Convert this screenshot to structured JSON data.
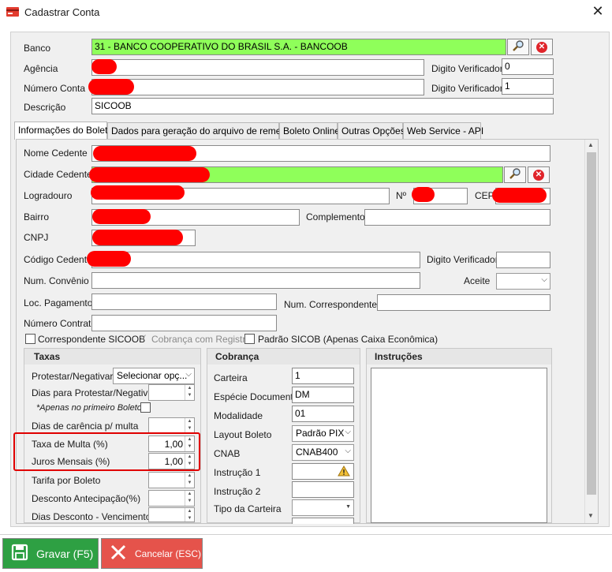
{
  "window": {
    "title": "Cadastrar Conta"
  },
  "form": {
    "banco_label": "Banco",
    "banco_value": "31 - BANCO COOPERATIVO DO BRASIL S.A. - BANCOOB",
    "agencia_label": "Agência",
    "digito_label": "Digito Verificador",
    "digito_agencia": "0",
    "numero_conta_label": "Número Conta",
    "digito_conta": "1",
    "descricao_label": "Descrição",
    "descricao_value": "SICOOB"
  },
  "tabs": [
    {
      "label": "Informações do Boleto"
    },
    {
      "label": "Dados para geração do arquivo de remessa"
    },
    {
      "label": "Boleto Online"
    },
    {
      "label": "Outras Opções"
    },
    {
      "label": "Web Service - API"
    }
  ],
  "boleto": {
    "nome_cedente": "Nome Cedente",
    "cidade_cedente": "Cidade Cedente",
    "logradouro": "Logradouro",
    "numero": "Nº",
    "cep": "CEP",
    "bairro": "Bairro",
    "complemento": "Complemento",
    "cnpj": "CNPJ",
    "codigo_cedente": "Código Cedente",
    "digito_verificador": "Digito Verificador",
    "num_convenio": "Num. Convênio",
    "aceite": "Aceite",
    "loc_pagamento": "Loc. Pagamento",
    "num_correspondente": "Num. Correspondente",
    "numero_contrato": "Número Contrato",
    "chk_correspondente": "Correspondente SICOOB",
    "chk_cobranca_registro": "Cobrança com Registro",
    "chk_padrao_sicob": "Padrão SICOB (Apenas Caixa Econômica)"
  },
  "taxas": {
    "title": "Taxas",
    "protestar_label": "Protestar/Negativar?",
    "protestar_value": "Selecionar opç...",
    "dias_protestar_label": "Dias para Protestar/Negativar",
    "apenas_primeiro": "*Apenas no primeiro Boleto",
    "dias_carencia_label": "Dias de carência p/ multa",
    "taxa_multa_label": "Taxa de Multa (%)",
    "taxa_multa_value": "1,00",
    "juros_label": "Juros Mensais (%)",
    "juros_value": "1,00",
    "tarifa_label": "Tarifa por Boleto",
    "desconto_antecipacao_label": "Desconto Antecipação(%)",
    "dias_desconto_label": "Dias Desconto - Vencimento"
  },
  "cobranca": {
    "title": "Cobrança",
    "carteira_label": "Carteira",
    "carteira_value": "1",
    "especie_label": "Espécie Documento",
    "especie_value": "DM",
    "modalidade_label": "Modalidade",
    "modalidade_value": "01",
    "layout_label": "Layout Boleto",
    "layout_value": "Padrão PIX",
    "cnab_label": "CNAB",
    "cnab_value": "CNAB400",
    "instrucao1_label": "Instrução 1",
    "instrucao2_label": "Instrução 2",
    "tipo_carteira_label": "Tipo da Carteira"
  },
  "instrucoes": {
    "title": "Instruções"
  },
  "buttons": {
    "gravar": "Gravar (F5)",
    "cancelar": "Cancelar (ESC)"
  },
  "colors": {
    "highlight_green": "#8fff5a",
    "gravar_bg": "#2ea043",
    "cancelar_bg": "#e5534b",
    "annotation_red": "#e00000"
  }
}
